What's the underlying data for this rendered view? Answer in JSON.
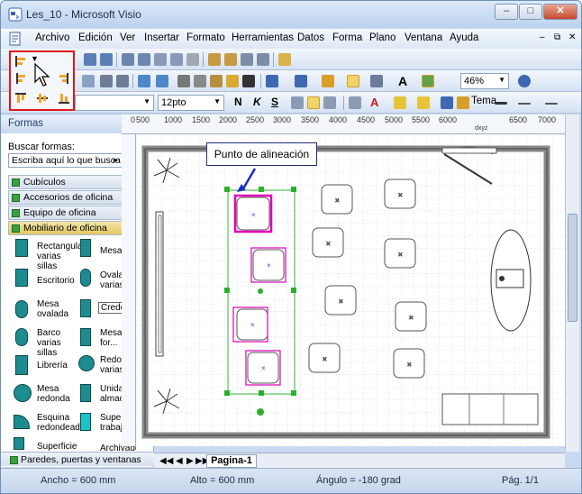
{
  "window": {
    "title": "Les_10 - Microsoft Visio"
  },
  "menu": [
    "Archivo",
    "Edición",
    "Ver",
    "Insertar",
    "Formato",
    "Herramientas",
    "Datos",
    "Forma",
    "Plano",
    "Ventana",
    "Ayuda"
  ],
  "toolbar": {
    "zoom": "46%",
    "font_size": "12pto",
    "bold": "N",
    "italic": "K",
    "underline": "S",
    "theme": "Tema",
    "font_color_label": "A",
    "text_tool_label": "A"
  },
  "shapes_panel": {
    "title": "Formas",
    "search_label": "Buscar formas:",
    "search_placeholder": "Escriba aquí lo que busca",
    "stencils": [
      "Cubículos",
      "Accesorios de oficina",
      "Equipo de oficina",
      "Mobiliario de oficina"
    ],
    "shapes_left": [
      "Rectangular varias sillas",
      "Escritorio",
      "Mesa ovalada",
      "Barco varias sillas",
      "Librería",
      "Mesa redonda",
      "Esquina redondeada",
      "Superficie"
    ],
    "shapes_right": [
      "Mesa",
      "Ovala varias",
      "Crede",
      "Mesa for...",
      "Redon varias",
      "Unida almac",
      "Superf trabaj",
      "Archivador"
    ],
    "bottom_stencil": "Paredes, puertas y ventanas"
  },
  "ruler": {
    "marks": [
      "0",
      "500",
      "1000",
      "1500",
      "2000",
      "2500",
      "3000",
      "3500",
      "4000",
      "4500",
      "5000",
      "5500",
      "6000",
      "6500",
      "7000"
    ],
    "small_label": "dxyz"
  },
  "callout": "Punto de alineación",
  "page_tab": "Pagina-1",
  "status": {
    "width": "Ancho = 600 mm",
    "height": "Alto = 600 mm",
    "angle": "Ángulo = -180 grad",
    "page": "Pág. 1/1"
  },
  "colors": {
    "selection": "#e000b8",
    "guide": "#35b335",
    "handle": "#2bb02b",
    "callout_arrow": "#1b2fbf",
    "highlight": "#e0181b"
  }
}
